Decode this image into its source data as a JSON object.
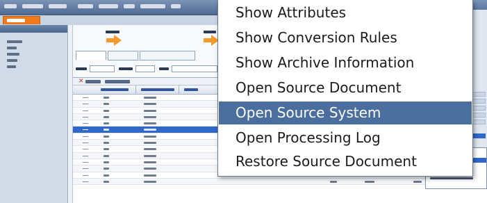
{
  "context_menu": {
    "items": [
      {
        "label": "Show Attributes"
      },
      {
        "label": "Show Conversion Rules"
      },
      {
        "label": "Show Archive Information"
      },
      {
        "label": "Open Source Document"
      },
      {
        "label": "Open Source System",
        "highlighted": true
      },
      {
        "label": "Open Processing Log"
      },
      {
        "label": "Restore Source Document"
      }
    ]
  },
  "colors": {
    "accent_tab": "#f07a1a",
    "menu_highlight": "#4a6f9e",
    "row_selection": "#2f68c8"
  }
}
